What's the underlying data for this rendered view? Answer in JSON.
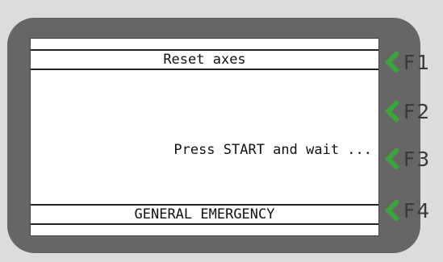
{
  "screen": {
    "header_title": "Reset axes",
    "message": "Press START and wait ...",
    "footer_status": "GENERAL EMERGENCY"
  },
  "function_keys": [
    {
      "label": "F1",
      "icon": "chevron-left-icon"
    },
    {
      "label": "F2",
      "icon": "chevron-left-icon"
    },
    {
      "label": "F3",
      "icon": "chevron-left-icon"
    },
    {
      "label": "F4",
      "icon": "chevron-left-icon"
    }
  ],
  "colors": {
    "chevron": "#3aa53a",
    "bezel": "#666666",
    "background": "#dcdcdc"
  }
}
